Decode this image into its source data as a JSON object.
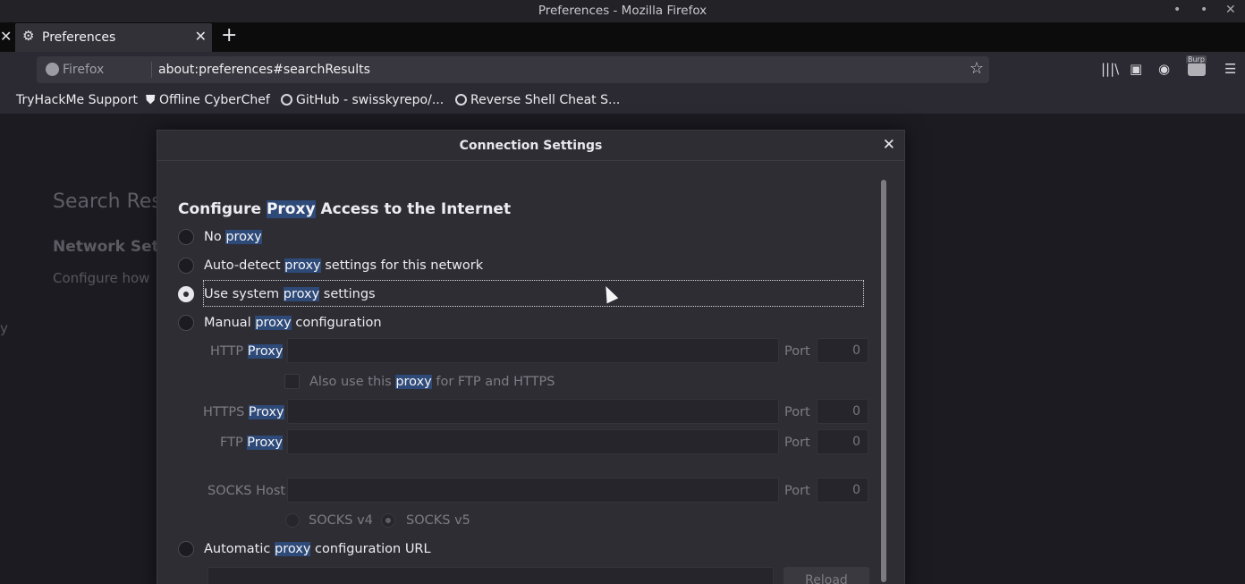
{
  "window": {
    "title": "Preferences - Mozilla Firefox",
    "controls": [
      "•",
      "•",
      "✕"
    ]
  },
  "tabs": {
    "left_close": "✕",
    "active_tab": {
      "icon": "gear-icon",
      "label": "Preferences",
      "close": "✕"
    },
    "new_tab": "+"
  },
  "navbar": {
    "identity": "Firefox",
    "url": "about:preferences#searchResults",
    "star": "☆"
  },
  "bookmarks": [
    {
      "label": "TryHackMe Support"
    },
    {
      "label": "Offline CyberChef"
    },
    {
      "label": "GitHub - swisskyrepo/..."
    },
    {
      "label": "Reverse Shell Cheat S..."
    }
  ],
  "background": {
    "search_results": "Search Res",
    "network_settings": "Network Sett",
    "configure_how": "Configure how",
    "y": "y"
  },
  "dialog": {
    "title": "Connection Settings",
    "close": "✕",
    "heading_pre": "Configure ",
    "heading_hl": "Proxy",
    "heading_post": " Access to the Internet",
    "options": {
      "no_proxy": {
        "pre": "No ",
        "hl": "proxy",
        "post": ""
      },
      "auto_detect": {
        "pre": "Auto-detect ",
        "hl": "proxy",
        "post": " settings for this network"
      },
      "system": {
        "pre": "Use system ",
        "hl": "proxy",
        "post": " settings"
      },
      "manual": {
        "pre": "Manual ",
        "hl": "proxy",
        "post": " configuration"
      },
      "auto_url": {
        "pre": "Automatic ",
        "hl": "proxy",
        "post": " configuration URL"
      }
    },
    "selected_option": "system",
    "http_proxy": {
      "label_pre": "HTTP ",
      "label_hl": "Proxy",
      "port_label": "Port",
      "port_value": "0"
    },
    "also_use": {
      "pre": "Also use this ",
      "hl": "proxy",
      "post": " for FTP and HTTPS"
    },
    "https_proxy": {
      "label_pre": "HTTPS ",
      "label_hl": "Proxy",
      "port_label": "Port",
      "port_value": "0"
    },
    "ftp_proxy": {
      "label_pre": "FTP ",
      "label_hl": "Proxy",
      "port_label": "Port",
      "port_value": "0"
    },
    "socks_host": {
      "label": "SOCKS Host",
      "port_label": "Port",
      "port_value": "0"
    },
    "socks_v4": "SOCKS v4",
    "socks_v5": "SOCKS v5",
    "reload": "Reload"
  }
}
